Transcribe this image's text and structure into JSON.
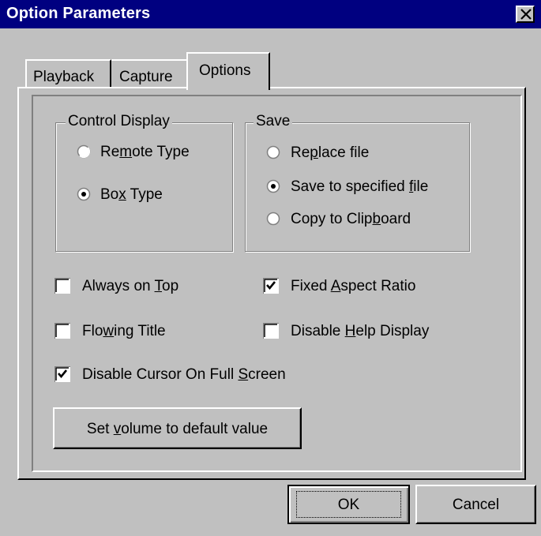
{
  "window": {
    "title": "Option Parameters",
    "close_icon": "close-icon"
  },
  "tabs": [
    {
      "label": "Playback",
      "selected": false
    },
    {
      "label": "Capture",
      "selected": false
    },
    {
      "label": "Options",
      "selected": true
    }
  ],
  "control_display": {
    "legend": "Control Display",
    "options": [
      {
        "pre": "Re",
        "key": "m",
        "post": "ote Type",
        "checked": false
      },
      {
        "pre": "Bo",
        "key": "x",
        "post": " Type",
        "checked": true
      }
    ]
  },
  "save": {
    "legend": "Save",
    "options": [
      {
        "pre": "Re",
        "key": "p",
        "post": "lace file",
        "checked": false
      },
      {
        "pre": "Save to specified ",
        "key": "f",
        "post": "ile",
        "checked": true
      },
      {
        "pre": "Copy to Clip",
        "key": "b",
        "post": "oard",
        "checked": false
      }
    ]
  },
  "checkboxes": {
    "always_on_top": {
      "pre": "Always on ",
      "key": "T",
      "post": "op",
      "checked": false
    },
    "fixed_aspect": {
      "pre": "Fixed ",
      "key": "A",
      "post": "spect Ratio",
      "checked": true
    },
    "flowing_title": {
      "pre": "Flo",
      "key": "w",
      "post": "ing Title",
      "checked": false
    },
    "disable_help": {
      "pre": "Disable ",
      "key": "H",
      "post": "elp Display",
      "checked": false
    },
    "disable_cursor": {
      "pre": "Disable Cursor On Full ",
      "key": "S",
      "post": "creen",
      "checked": true
    }
  },
  "buttons": {
    "volume": {
      "pre": "Set ",
      "key": "v",
      "post": "olume to default value"
    },
    "ok": "OK",
    "cancel": "Cancel"
  },
  "colors": {
    "titlebar": "#000080",
    "face": "#c0c0c0",
    "shadow": "#808080",
    "highlight": "#ffffff"
  }
}
